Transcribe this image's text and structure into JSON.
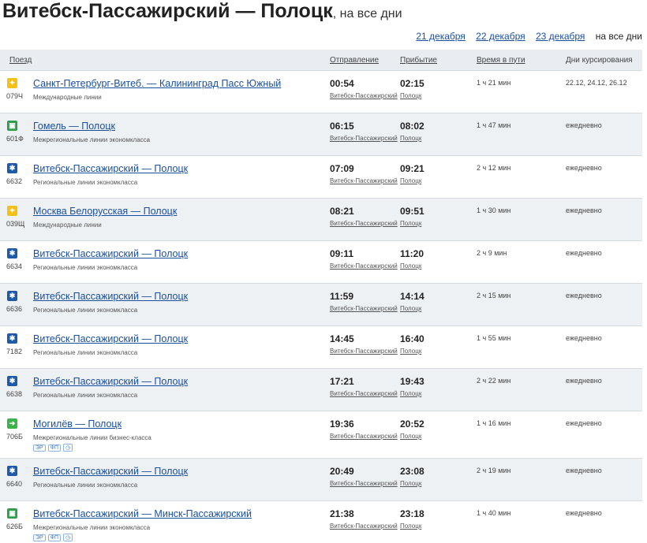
{
  "page": {
    "title": "Витебск-Пассажирский — Полоцк",
    "subtitle": ", на все дни"
  },
  "datebar": {
    "links": [
      "21 декабря",
      "22 декабря",
      "23 декабря"
    ],
    "current": "на все дни"
  },
  "table": {
    "headers": {
      "train": "Поезд",
      "departure": "Отправление",
      "arrival": "Прибытие",
      "duration": "Время в пути",
      "days": "Дни курсирования"
    },
    "rows": [
      {
        "icon": "international-train-icon",
        "num": "079Ч",
        "name": "Санкт-Петербург-Витеб. — Калининград Пасс Южный",
        "category": "Международные линии",
        "dep": "00:54",
        "dep_station": "Витебск-Пассажирский",
        "arr": "02:15",
        "arr_station": "Полоцк",
        "duration": "1 ч 21 мин",
        "days": "22.12, 24.12, 26.12"
      },
      {
        "icon": "interregional-train-icon",
        "num": "601Ф",
        "name": "Гомель — Полоцк",
        "category": "Межрегиональные линии экономкласса",
        "dep": "06:15",
        "dep_station": "Витебск-Пассажирский",
        "arr": "08:02",
        "arr_station": "Полоцк",
        "duration": "1 ч 47 мин",
        "days": "ежедневно"
      },
      {
        "icon": "regional-train-icon",
        "num": "6632",
        "name": "Витебск-Пассажирский — Полоцк",
        "category": "Региональные линии экономкласса",
        "dep": "07:09",
        "dep_station": "Витебск-Пассажирский",
        "arr": "09:21",
        "arr_station": "Полоцк",
        "duration": "2 ч 12 мин",
        "days": "ежедневно"
      },
      {
        "icon": "international-train-icon",
        "num": "039Щ",
        "name": "Москва Белорусская — Полоцк",
        "category": "Международные линии",
        "dep": "08:21",
        "dep_station": "Витебск-Пассажирский",
        "arr": "09:51",
        "arr_station": "Полоцк",
        "duration": "1 ч 30 мин",
        "days": "ежедневно"
      },
      {
        "icon": "regional-train-icon",
        "num": "6634",
        "name": "Витебск-Пассажирский — Полоцк",
        "category": "Региональные линии экономкласса",
        "dep": "09:11",
        "dep_station": "Витебск-Пассажирский",
        "arr": "11:20",
        "arr_station": "Полоцк",
        "duration": "2 ч 9 мин",
        "days": "ежедневно"
      },
      {
        "icon": "regional-train-icon",
        "num": "6636",
        "name": "Витебск-Пассажирский — Полоцк",
        "category": "Региональные линии экономкласса",
        "dep": "11:59",
        "dep_station": "Витебск-Пассажирский",
        "arr": "14:14",
        "arr_station": "Полоцк",
        "duration": "2 ч 15 мин",
        "days": "ежедневно"
      },
      {
        "icon": "regional-train-icon",
        "num": "7182",
        "name": "Витебск-Пассажирский — Полоцк",
        "category": "Региональные линии экономкласса",
        "dep": "14:45",
        "dep_station": "Витебск-Пассажирский",
        "arr": "16:40",
        "arr_station": "Полоцк",
        "duration": "1 ч 55 мин",
        "days": "ежедневно"
      },
      {
        "icon": "regional-train-icon",
        "num": "6638",
        "name": "Витебск-Пассажирский — Полоцк",
        "category": "Региональные линии экономкласса",
        "dep": "17:21",
        "dep_station": "Витебск-Пассажирский",
        "arr": "19:43",
        "arr_station": "Полоцк",
        "duration": "2 ч 22 мин",
        "days": "ежедневно"
      },
      {
        "icon": "business-train-icon",
        "num": "706Б",
        "name": "Могилёв — Полоцк",
        "category": "Межрегиональные линии бизнес-класса",
        "badges": [
          "ЭР",
          "ФП",
          "◷"
        ],
        "dep": "19:36",
        "dep_station": "Витебск-Пассажирский",
        "arr": "20:52",
        "arr_station": "Полоцк",
        "duration": "1 ч 16 мин",
        "days": "ежедневно"
      },
      {
        "icon": "regional-train-icon",
        "num": "6640",
        "name": "Витебск-Пассажирский — Полоцк",
        "category": "Региональные линии экономкласса",
        "dep": "20:49",
        "dep_station": "Витебск-Пассажирский",
        "arr": "23:08",
        "arr_station": "Полоцк",
        "duration": "2 ч 19 мин",
        "days": "ежедневно"
      },
      {
        "icon": "interregional-train-icon",
        "num": "626Б",
        "name": "Витебск-Пассажирский — Минск-Пассажирский",
        "category": "Межрегиональные линии экономкласса",
        "badges": [
          "ЭР",
          "ФП",
          "◷"
        ],
        "dep": "21:38",
        "dep_station": "Витебск-Пассажирский",
        "arr": "23:18",
        "arr_station": "Полоцк",
        "duration": "1 ч 40 мин",
        "days": "ежедневно"
      }
    ]
  },
  "icon_colors": {
    "international-train-icon": "#f2c21b",
    "interregional-train-icon": "#2e9e4a",
    "regional-train-icon": "#1e5aa8",
    "business-train-icon": "#3bb54a"
  },
  "icon_glyphs": {
    "international-train-icon": "✦",
    "interregional-train-icon": "▣",
    "regional-train-icon": "✱",
    "business-train-icon": "➔"
  }
}
